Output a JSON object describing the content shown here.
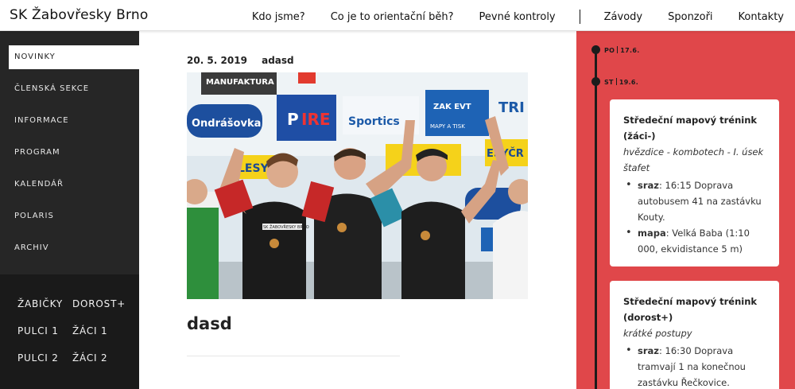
{
  "header": {
    "brand": "SK Žabovřesky Brno",
    "nav": [
      "Kdo jsme?",
      "Co je to orientační běh?",
      "Pevné kontroly",
      "Závody",
      "Sponzoři",
      "Kontakty"
    ]
  },
  "sidebar": {
    "menu": [
      "NOVINKY",
      "ČLENSKÁ SEKCE",
      "INFORMACE",
      "PROGRAM",
      "KALENDÁŘ",
      "POLARIS",
      "ARCHIV"
    ],
    "active_index": 0,
    "groups": [
      "ŽABIČKY",
      "DOROST+",
      "PULCI 1",
      "ŽÁCI 1",
      "PULCI 2",
      "ŽÁCI 2"
    ]
  },
  "post": {
    "date": "20. 5. 2019",
    "author": "adasd",
    "title": "dasd",
    "photo_banner_words": [
      "MANUFAKTURA",
      "Ondrášovka",
      "Sportics",
      "LESYČR",
      "ESYČR",
      "MAPY A TISK",
      "TRI",
      "ZAK EVT",
      "SK ŽABOVŘESKY BRNO"
    ]
  },
  "timeline": {
    "days": [
      {
        "day": "PO",
        "date": "17.6."
      },
      {
        "day": "ST",
        "date": "19.6."
      }
    ],
    "events": [
      {
        "title": "Středeční mapový trénink (žáci-)",
        "subtitle": "hvězdice - kombotech - I. úsek štafet",
        "items": [
          {
            "key": "sraz",
            "text": ": 16:15 Doprava autobusem 41 na zastávku Kouty."
          },
          {
            "key": "mapa",
            "text": ": Velká Baba (1:10 000, ekvidistance 5 m)"
          }
        ]
      },
      {
        "title": "Středeční mapový trénink (dorost+)",
        "subtitle": "krátké postupy",
        "items": [
          {
            "key": "sraz",
            "text": ": 16:30 Doprava tramvají 1 na konečnou zastávku Řečkovice."
          }
        ]
      }
    ]
  },
  "colors": {
    "accent_red": "#e0474a",
    "sidebar_dark": "#262626",
    "sidebar_darker": "#1a1a1a"
  }
}
